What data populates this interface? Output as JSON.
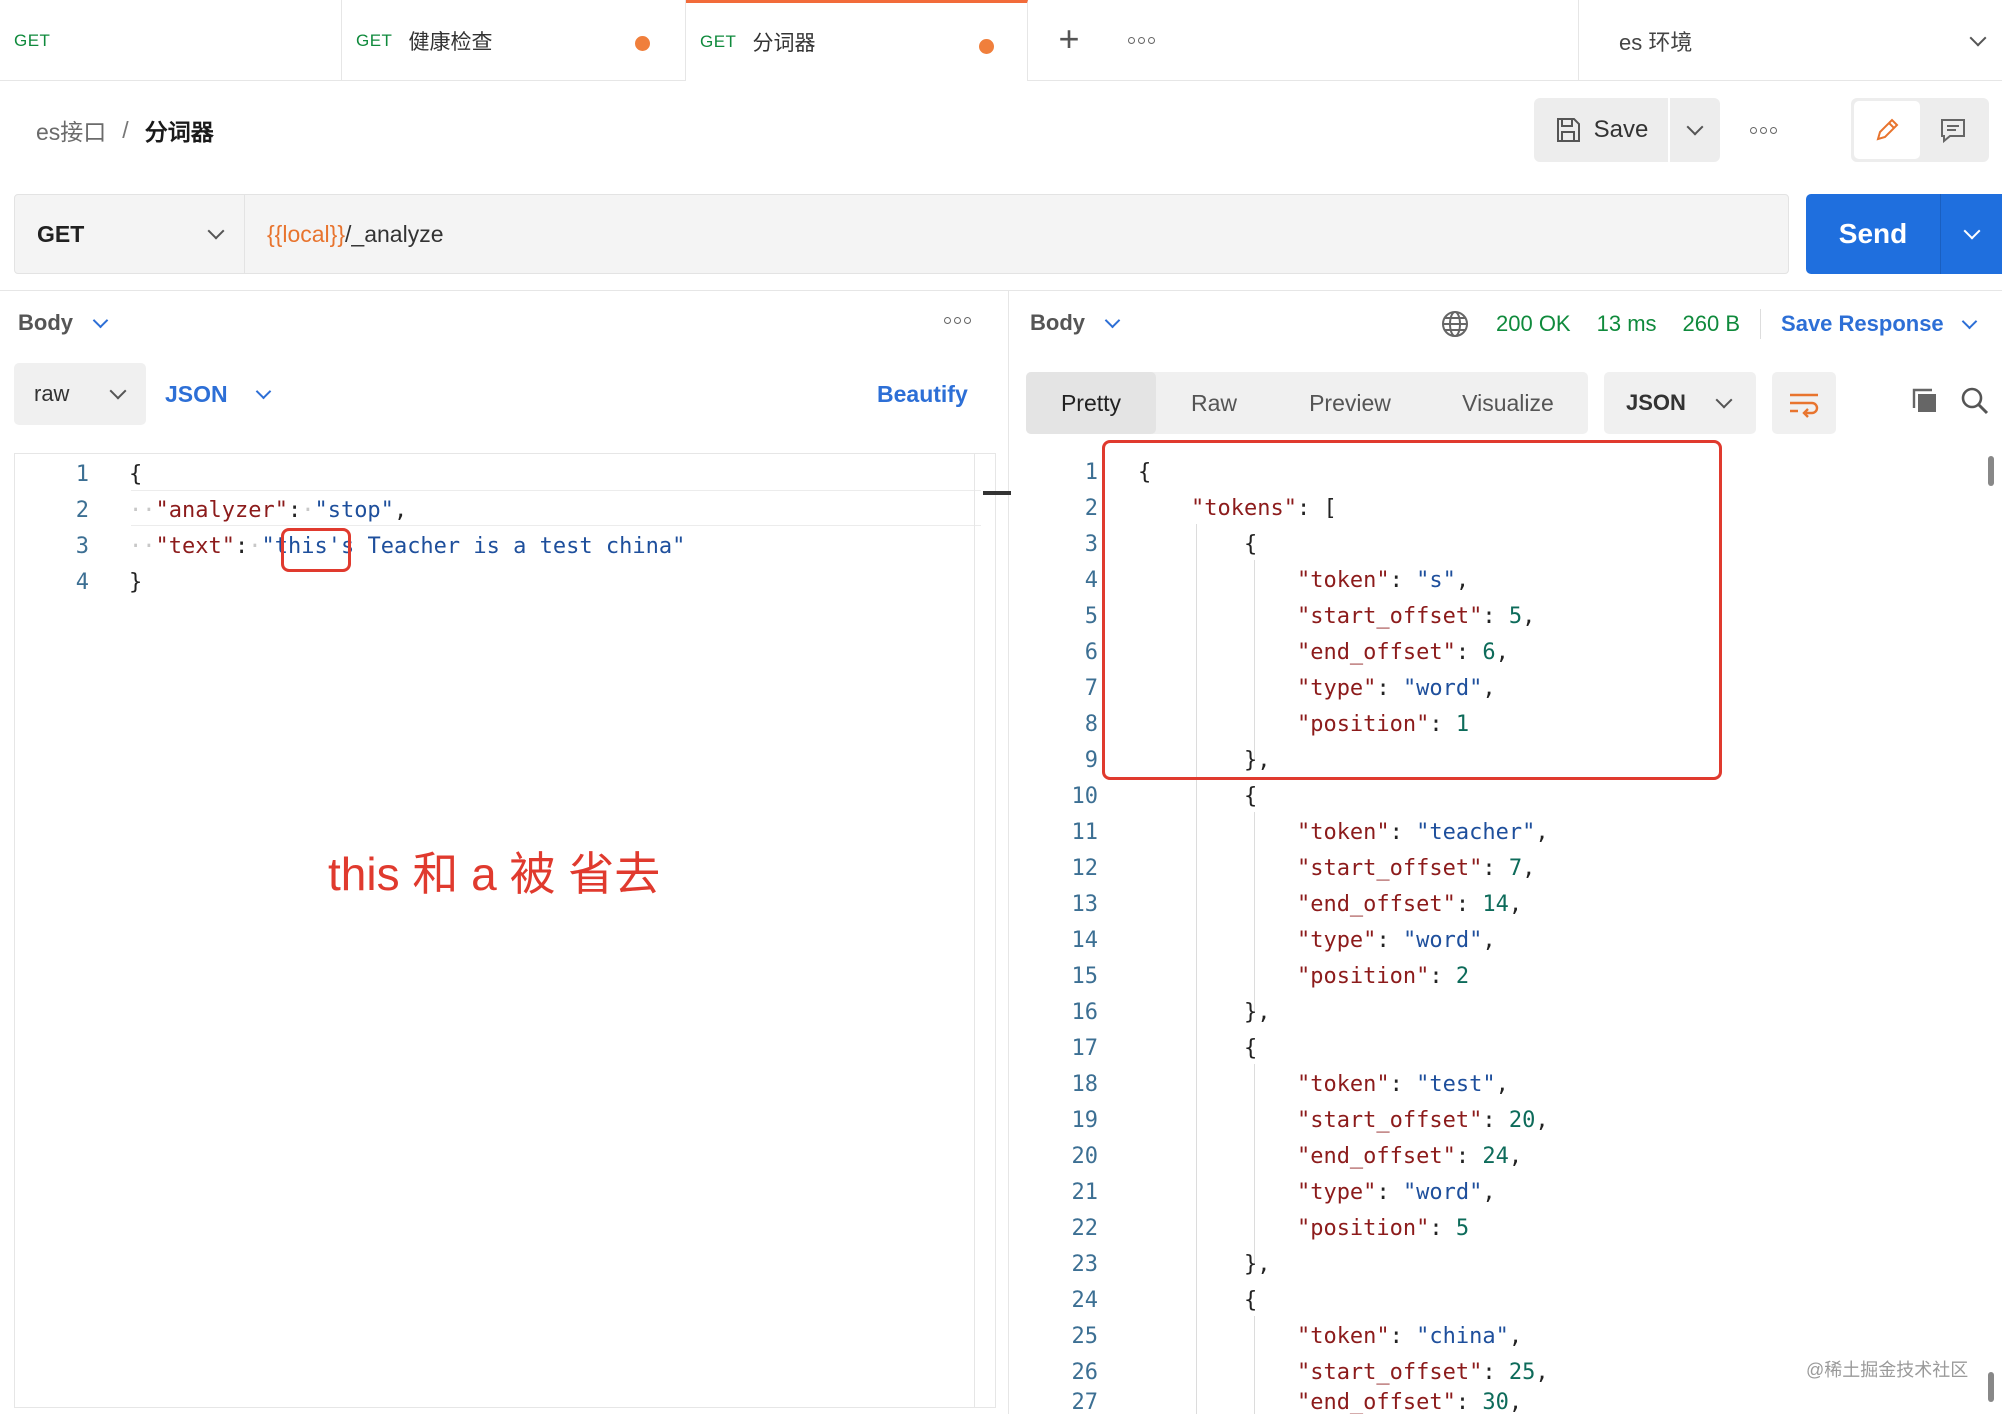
{
  "tabs": [
    {
      "method": "GET",
      "name": ""
    },
    {
      "method": "GET",
      "name": "健康检查"
    },
    {
      "method": "GET",
      "name": "分词器"
    }
  ],
  "environment": "es 环境",
  "breadcrumb": {
    "parent": "es接口",
    "separator": "/",
    "current": "分词器"
  },
  "toolbar": {
    "save_label": "Save"
  },
  "request": {
    "method": "GET",
    "url_variable": "{{local}}",
    "url_path": "/_analyze",
    "send_label": "Send"
  },
  "request_body": {
    "title": "Body",
    "mode": "raw",
    "language": "JSON",
    "beautify_label": "Beautify",
    "lines": [
      {
        "n": "1"
      },
      {
        "n": "2"
      },
      {
        "n": "3"
      },
      {
        "n": "4"
      }
    ],
    "key_analyzer": "\"analyzer\"",
    "val_analyzer": "\"stop\"",
    "key_text": "\"text\"",
    "val_text_q": "\"",
    "val_text_this": "this",
    "val_text_rest": "'s Teacher is a test china\""
  },
  "annotation": "this 和 a 被 省去",
  "response": {
    "title": "Body",
    "status": "200 OK",
    "time": "13 ms",
    "size": "260 B",
    "save_response_label": "Save Response",
    "view_tabs": [
      "Pretty",
      "Raw",
      "Preview",
      "Visualize"
    ],
    "format": "JSON",
    "lines": [
      "1",
      "2",
      "3",
      "4",
      "5",
      "6",
      "7",
      "8",
      "9",
      "10",
      "11",
      "12",
      "13",
      "14",
      "15",
      "16",
      "17",
      "18",
      "19",
      "20",
      "21",
      "22",
      "23",
      "24",
      "25",
      "26",
      "27"
    ],
    "tokens": [
      {
        "token": "\"s\"",
        "start_offset": "5",
        "end_offset": "6",
        "type": "\"word\"",
        "position": "1"
      },
      {
        "token": "\"teacher\"",
        "start_offset": "7",
        "end_offset": "14",
        "type": "\"word\"",
        "position": "2"
      },
      {
        "token": "\"test\"",
        "start_offset": "20",
        "end_offset": "24",
        "type": "\"word\"",
        "position": "5"
      },
      {
        "token": "\"china\"",
        "start_offset": "25",
        "end_offset": "30"
      }
    ]
  },
  "watermark": "@稀土掘金技术社区",
  "icons": [
    "plus-icon",
    "more-icon",
    "chevron-down-icon",
    "save-icon",
    "edit-icon",
    "comment-icon",
    "globe-icon",
    "wrap-icon",
    "copy-icon",
    "search-icon"
  ],
  "colors": {
    "accent": "#1f6fde",
    "get_method": "#0f8a3c",
    "unsaved_dot": "#f07f3c",
    "annotation": "#e03a2e"
  }
}
